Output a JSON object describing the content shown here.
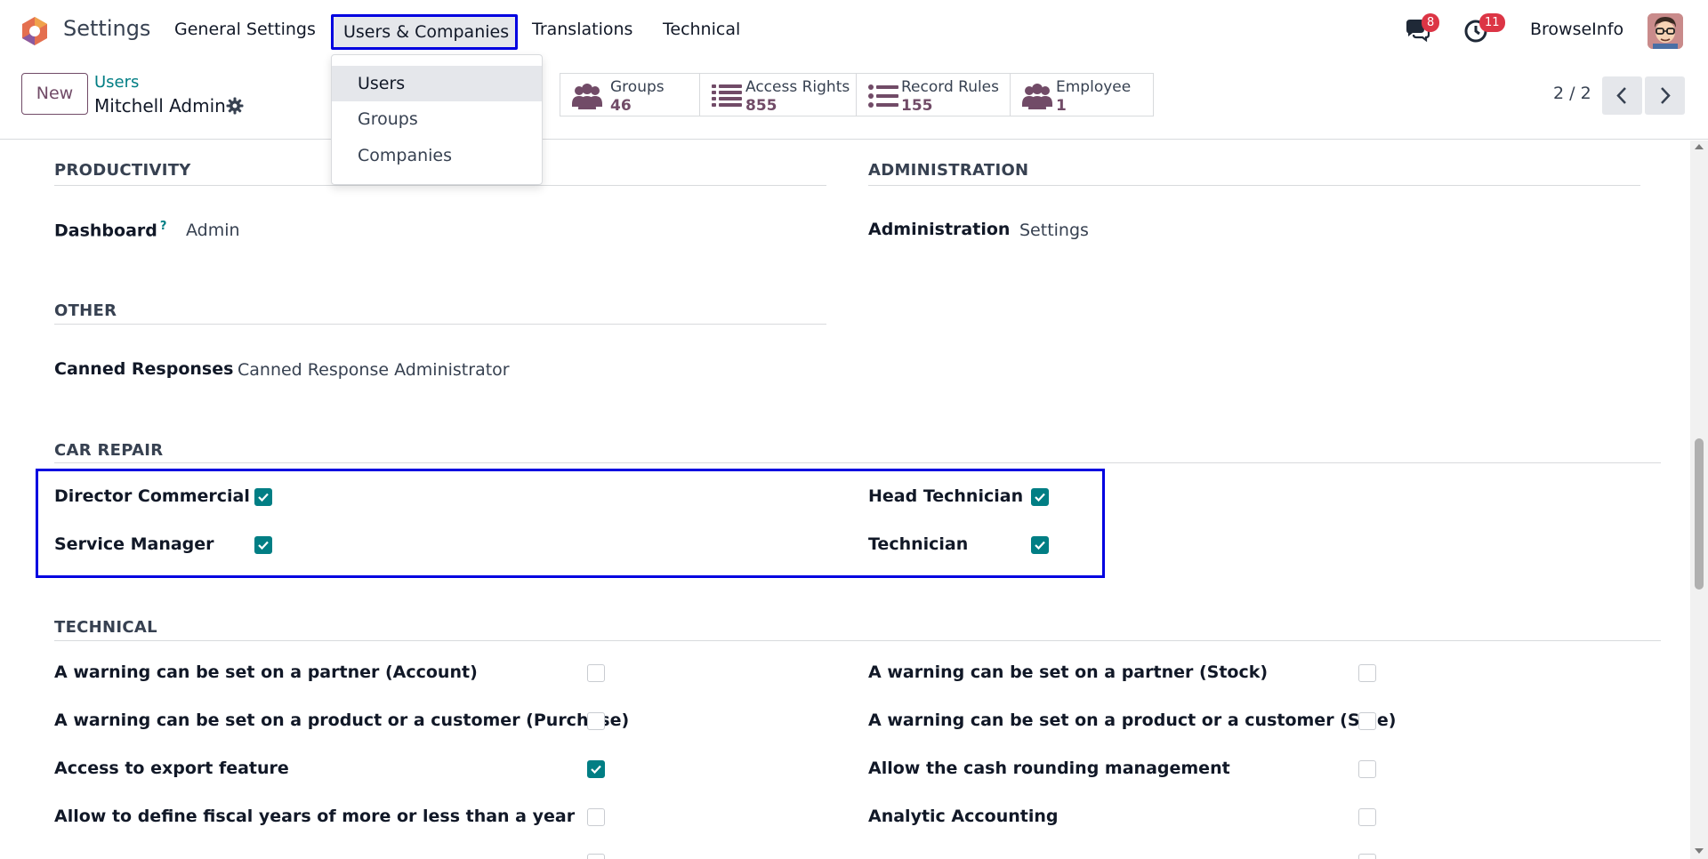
{
  "navbar": {
    "app_title": "Settings",
    "menu": [
      "General Settings",
      "Users & Companies",
      "Translations",
      "Technical"
    ],
    "active_menu": "Users & Companies",
    "messages_badge": "8",
    "activities_badge": "11",
    "company": "BrowseInfo"
  },
  "dropdown": {
    "items": [
      "Users",
      "Groups",
      "Companies"
    ],
    "active_item": "Users"
  },
  "control_panel": {
    "new_label": "New",
    "breadcrumb": "Users",
    "record_name": "Mitchell Admin",
    "smart_buttons": [
      {
        "label": "Groups",
        "value": "46",
        "icon": "users-icon"
      },
      {
        "label": "Access Rights",
        "value": "855",
        "icon": "list-icon"
      },
      {
        "label": "Record Rules",
        "value": "155",
        "icon": "list-icon"
      },
      {
        "label": "Employee",
        "value": "1",
        "icon": "users-icon"
      }
    ],
    "pager": "2 / 2"
  },
  "sections": {
    "productivity": {
      "title": "PRODUCTIVITY",
      "dashboard_label": "Dashboard",
      "dashboard_help": "?",
      "dashboard_value": "Admin"
    },
    "administration": {
      "title": "ADMINISTRATION",
      "label": "Administration",
      "value": "Settings"
    },
    "other": {
      "title": "OTHER",
      "canned_label": "Canned Responses",
      "canned_value": "Canned Response Administrator"
    },
    "car_repair": {
      "title": "CAR REPAIR",
      "fields": [
        {
          "label": "Director Commercial",
          "checked": true
        },
        {
          "label": "Head Technician",
          "checked": true
        },
        {
          "label": "Service Manager",
          "checked": true
        },
        {
          "label": "Technician",
          "checked": true
        }
      ]
    },
    "technical": {
      "title": "TECHNICAL",
      "fields": [
        {
          "label": "A warning can be set on a partner (Account)",
          "checked": false
        },
        {
          "label": "A warning can be set on a partner (Stock)",
          "checked": false
        },
        {
          "label": "A warning can be set on a product or a customer (Purchase)",
          "checked": false
        },
        {
          "label": "A warning can be set on a product or a customer (Sale)",
          "checked": false
        },
        {
          "label": "Access to export feature",
          "checked": true
        },
        {
          "label": "Allow the cash rounding management",
          "checked": false
        },
        {
          "label": "Allow to define fiscal years of more or less than a year",
          "checked": false
        },
        {
          "label": "Analytic Accounting",
          "checked": false
        }
      ]
    }
  },
  "colors": {
    "brand": "#714b67",
    "accent": "#017e84",
    "highlight": "#0000e0",
    "badge": "#dc3545"
  }
}
